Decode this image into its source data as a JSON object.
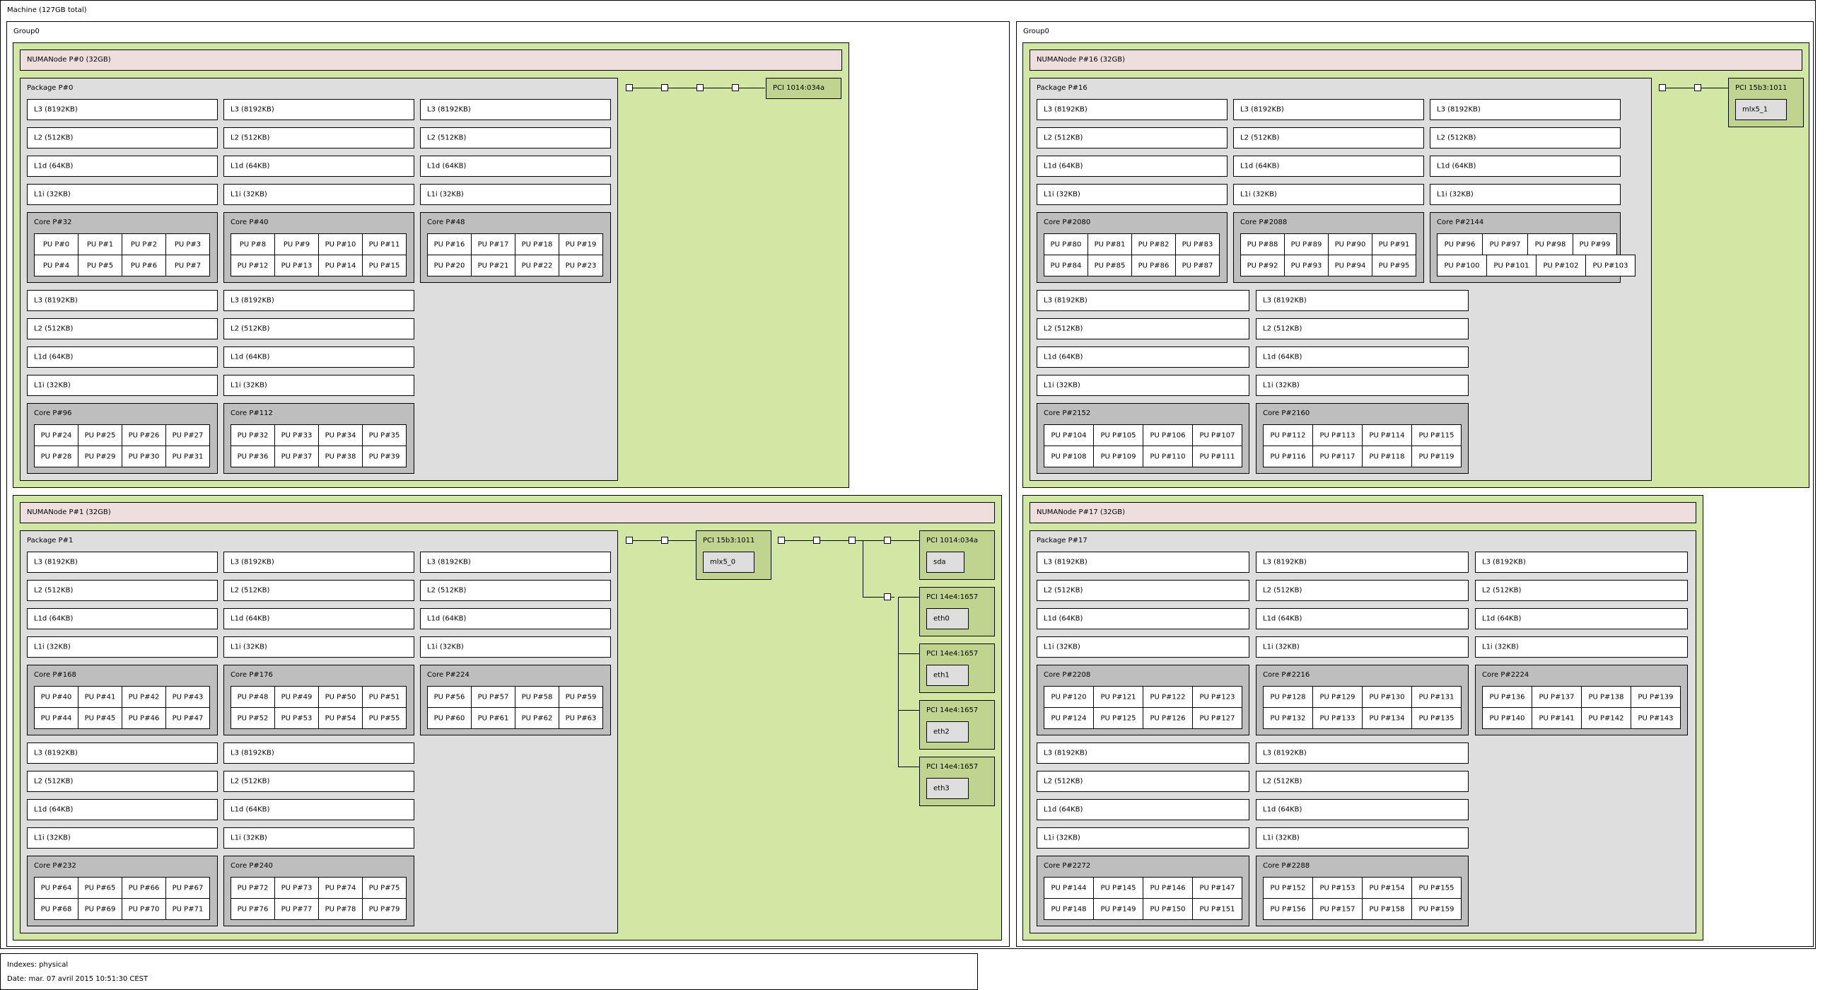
{
  "machine": {
    "label": "Machine (127GB total)"
  },
  "groups": [
    {
      "label": "Group0"
    },
    {
      "label": "Group0"
    }
  ],
  "numa": [
    {
      "label": "NUMANode P#0 (32GB)",
      "package": {
        "label": "Package P#0",
        "blocks": [
          {
            "caches": [
              "L3 (8192KB)",
              "L2 (512KB)",
              "L1d (64KB)",
              "L1i (32KB)"
            ],
            "core": "Core P#32",
            "pus": [
              "PU P#0",
              "PU P#1",
              "PU P#2",
              "PU P#3",
              "PU P#4",
              "PU P#5",
              "PU P#6",
              "PU P#7"
            ]
          },
          {
            "caches": [
              "L3 (8192KB)",
              "L2 (512KB)",
              "L1d (64KB)",
              "L1i (32KB)"
            ],
            "core": "Core P#40",
            "pus": [
              "PU P#8",
              "PU P#9",
              "PU P#10",
              "PU P#11",
              "PU P#12",
              "PU P#13",
              "PU P#14",
              "PU P#15"
            ]
          },
          {
            "caches": [
              "L3 (8192KB)",
              "L2 (512KB)",
              "L1d (64KB)",
              "L1i (32KB)"
            ],
            "core": "Core P#48",
            "pus": [
              "PU P#16",
              "PU P#17",
              "PU P#18",
              "PU P#19",
              "PU P#20",
              "PU P#21",
              "PU P#22",
              "PU P#23"
            ]
          },
          {
            "caches": [
              "L3 (8192KB)",
              "L2 (512KB)",
              "L1d (64KB)",
              "L1i (32KB)"
            ],
            "core": "Core P#96",
            "pus": [
              "PU P#24",
              "PU P#25",
              "PU P#26",
              "PU P#27",
              "PU P#28",
              "PU P#29",
              "PU P#30",
              "PU P#31"
            ]
          },
          {
            "caches": [
              "L3 (8192KB)",
              "L2 (512KB)",
              "L1d (64KB)",
              "L1i (32KB)"
            ],
            "core": "Core P#112",
            "pus": [
              "PU P#32",
              "PU P#33",
              "PU P#34",
              "PU P#35",
              "PU P#36",
              "PU P#37",
              "PU P#38",
              "PU P#39"
            ]
          }
        ]
      },
      "pci": [
        {
          "label": "PCI 1014:034a"
        }
      ]
    },
    {
      "label": "NUMANode P#1 (32GB)",
      "package": {
        "label": "Package P#1",
        "blocks": [
          {
            "caches": [
              "L3 (8192KB)",
              "L2 (512KB)",
              "L1d (64KB)",
              "L1i (32KB)"
            ],
            "core": "Core P#168",
            "pus": [
              "PU P#40",
              "PU P#41",
              "PU P#42",
              "PU P#43",
              "PU P#44",
              "PU P#45",
              "PU P#46",
              "PU P#47"
            ]
          },
          {
            "caches": [
              "L3 (8192KB)",
              "L2 (512KB)",
              "L1d (64KB)",
              "L1i (32KB)"
            ],
            "core": "Core P#176",
            "pus": [
              "PU P#48",
              "PU P#49",
              "PU P#50",
              "PU P#51",
              "PU P#52",
              "PU P#53",
              "PU P#54",
              "PU P#55"
            ]
          },
          {
            "caches": [
              "L3 (8192KB)",
              "L2 (512KB)",
              "L1d (64KB)",
              "L1i (32KB)"
            ],
            "core": "Core P#224",
            "pus": [
              "PU P#56",
              "PU P#57",
              "PU P#58",
              "PU P#59",
              "PU P#60",
              "PU P#61",
              "PU P#62",
              "PU P#63"
            ]
          },
          {
            "caches": [
              "L3 (8192KB)",
              "L2 (512KB)",
              "L1d (64KB)",
              "L1i (32KB)"
            ],
            "core": "Core P#232",
            "pus": [
              "PU P#64",
              "PU P#65",
              "PU P#66",
              "PU P#67",
              "PU P#68",
              "PU P#69",
              "PU P#70",
              "PU P#71"
            ]
          },
          {
            "caches": [
              "L3 (8192KB)",
              "L2 (512KB)",
              "L1d (64KB)",
              "L1i (32KB)"
            ],
            "core": "Core P#240",
            "pus": [
              "PU P#72",
              "PU P#73",
              "PU P#74",
              "PU P#75",
              "PU P#76",
              "PU P#77",
              "PU P#78",
              "PU P#79"
            ]
          }
        ]
      },
      "pci": [
        {
          "label": "PCI 15b3:1011",
          "device": "mlx5_0"
        },
        {
          "label": "PCI 1014:034a",
          "device": "sda"
        },
        {
          "label": "PCI 14e4:1657",
          "device": "eth0"
        },
        {
          "label": "PCI 14e4:1657",
          "device": "eth1"
        },
        {
          "label": "PCI 14e4:1657",
          "device": "eth2"
        },
        {
          "label": "PCI 14e4:1657",
          "device": "eth3"
        }
      ]
    },
    {
      "label": "NUMANode P#16 (32GB)",
      "package": {
        "label": "Package P#16",
        "blocks": [
          {
            "caches": [
              "L3 (8192KB)",
              "L2 (512KB)",
              "L1d (64KB)",
              "L1i (32KB)"
            ],
            "core": "Core P#2080",
            "pus": [
              "PU P#80",
              "PU P#81",
              "PU P#82",
              "PU P#83",
              "PU P#84",
              "PU P#85",
              "PU P#86",
              "PU P#87"
            ]
          },
          {
            "caches": [
              "L3 (8192KB)",
              "L2 (512KB)",
              "L1d (64KB)",
              "L1i (32KB)"
            ],
            "core": "Core P#2088",
            "pus": [
              "PU P#88",
              "PU P#89",
              "PU P#90",
              "PU P#91",
              "PU P#92",
              "PU P#93",
              "PU P#94",
              "PU P#95"
            ]
          },
          {
            "caches": [
              "L3 (8192KB)",
              "L2 (512KB)",
              "L1d (64KB)",
              "L1i (32KB)"
            ],
            "core": "Core P#2144",
            "pus": [
              "PU P#96",
              "PU P#97",
              "PU P#98",
              "PU P#99",
              "PU P#100",
              "PU P#101",
              "PU P#102",
              "PU P#103"
            ]
          },
          {
            "caches": [
              "L3 (8192KB)",
              "L2 (512KB)",
              "L1d (64KB)",
              "L1i (32KB)"
            ],
            "core": "Core P#2152",
            "pus": [
              "PU P#104",
              "PU P#105",
              "PU P#106",
              "PU P#107",
              "PU P#108",
              "PU P#109",
              "PU P#110",
              "PU P#111"
            ]
          },
          {
            "caches": [
              "L3 (8192KB)",
              "L2 (512KB)",
              "L1d (64KB)",
              "L1i (32KB)"
            ],
            "core": "Core P#2160",
            "pus": [
              "PU P#112",
              "PU P#113",
              "PU P#114",
              "PU P#115",
              "PU P#116",
              "PU P#117",
              "PU P#118",
              "PU P#119"
            ]
          }
        ]
      },
      "pci": [
        {
          "label": "PCI 15b3:1011",
          "device": "mlx5_1"
        }
      ]
    },
    {
      "label": "NUMANode P#17 (32GB)",
      "package": {
        "label": "Package P#17",
        "blocks": [
          {
            "caches": [
              "L3 (8192KB)",
              "L2 (512KB)",
              "L1d (64KB)",
              "L1i (32KB)"
            ],
            "core": "Core P#2208",
            "pus": [
              "PU P#120",
              "PU P#121",
              "PU P#122",
              "PU P#123",
              "PU P#124",
              "PU P#125",
              "PU P#126",
              "PU P#127"
            ]
          },
          {
            "caches": [
              "L3 (8192KB)",
              "L2 (512KB)",
              "L1d (64KB)",
              "L1i (32KB)"
            ],
            "core": "Core P#2216",
            "pus": [
              "PU P#128",
              "PU P#129",
              "PU P#130",
              "PU P#131",
              "PU P#132",
              "PU P#133",
              "PU P#134",
              "PU P#135"
            ]
          },
          {
            "caches": [
              "L3 (8192KB)",
              "L2 (512KB)",
              "L1d (64KB)",
              "L1i (32KB)"
            ],
            "core": "Core P#2224",
            "pus": [
              "PU P#136",
              "PU P#137",
              "PU P#138",
              "PU P#139",
              "PU P#140",
              "PU P#141",
              "PU P#142",
              "PU P#143"
            ]
          },
          {
            "caches": [
              "L3 (8192KB)",
              "L2 (512KB)",
              "L1d (64KB)",
              "L1i (32KB)"
            ],
            "core": "Core P#2272",
            "pus": [
              "PU P#144",
              "PU P#145",
              "PU P#146",
              "PU P#147",
              "PU P#148",
              "PU P#149",
              "PU P#150",
              "PU P#151"
            ]
          },
          {
            "caches": [
              "L3 (8192KB)",
              "L2 (512KB)",
              "L1d (64KB)",
              "L1i (32KB)"
            ],
            "core": "Core P#2288",
            "pus": [
              "PU P#152",
              "PU P#153",
              "PU P#154",
              "PU P#155",
              "PU P#156",
              "PU P#157",
              "PU P#158",
              "PU P#159"
            ]
          }
        ]
      },
      "pci": []
    }
  ],
  "legend": {
    "indexes": "Indexes: physical",
    "date": "Date: mar. 07 avril 2015 10:51:30 CEST"
  },
  "colors": {
    "numa": "#d2e7a4",
    "numa_header": "#efdede",
    "package": "#dedede",
    "core": "#bebebe",
    "pci": "#c0d490"
  }
}
